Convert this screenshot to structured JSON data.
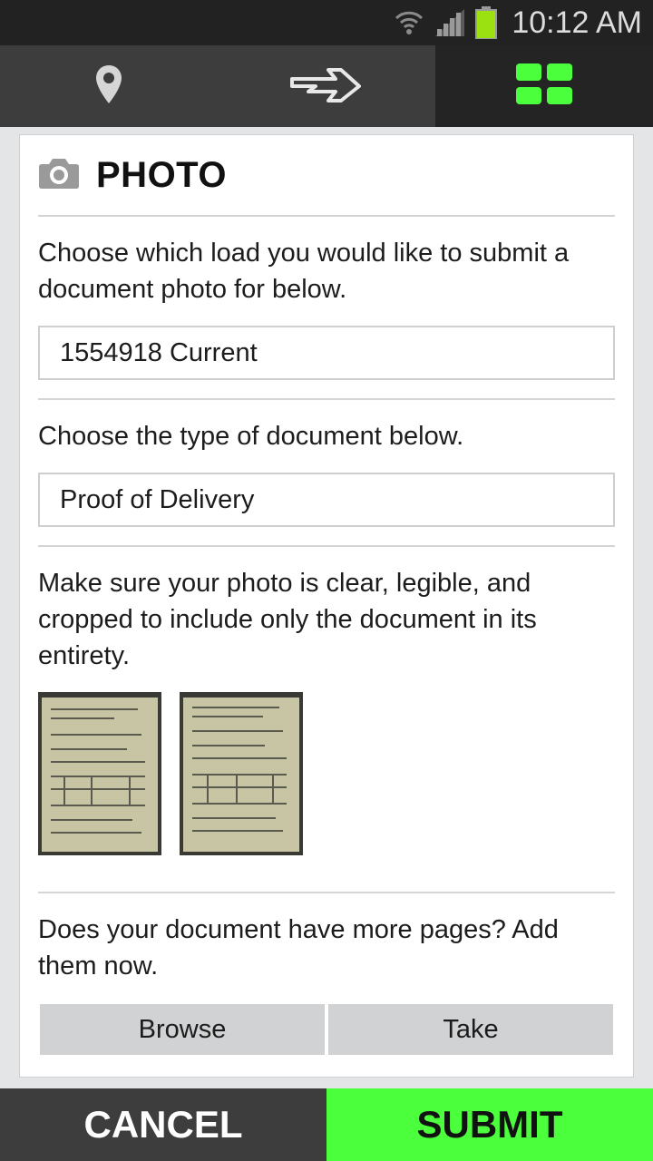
{
  "status_bar": {
    "time": "10:12 AM",
    "icons": [
      "wifi-icon",
      "signal-icon",
      "battery-icon"
    ],
    "battery_color": "#9be010"
  },
  "nav": {
    "tabs": [
      {
        "name": "location",
        "icon": "map-pin-icon",
        "active": false
      },
      {
        "name": "route",
        "icon": "arrow-right-icon",
        "active": false
      },
      {
        "name": "dashboard",
        "icon": "grid-icon",
        "active": true
      }
    ],
    "accent": "#4cff3c"
  },
  "card": {
    "title": "PHOTO",
    "title_icon": "camera-icon",
    "load_prompt": "Choose which load you would like to submit a document photo for below.",
    "load_value": "1554918 Current",
    "type_prompt": "Choose the type of document below.",
    "type_value": "Proof of Delivery",
    "instruction": "Make sure your photo is clear, legible, and cropped to include only the document in its entirety.",
    "more_pages_prompt": "Does your document have more pages? Add them now.",
    "browse_label": "Browse",
    "take_label": "Take"
  },
  "footer": {
    "cancel_label": "CANCEL",
    "submit_label": "SUBMIT"
  }
}
